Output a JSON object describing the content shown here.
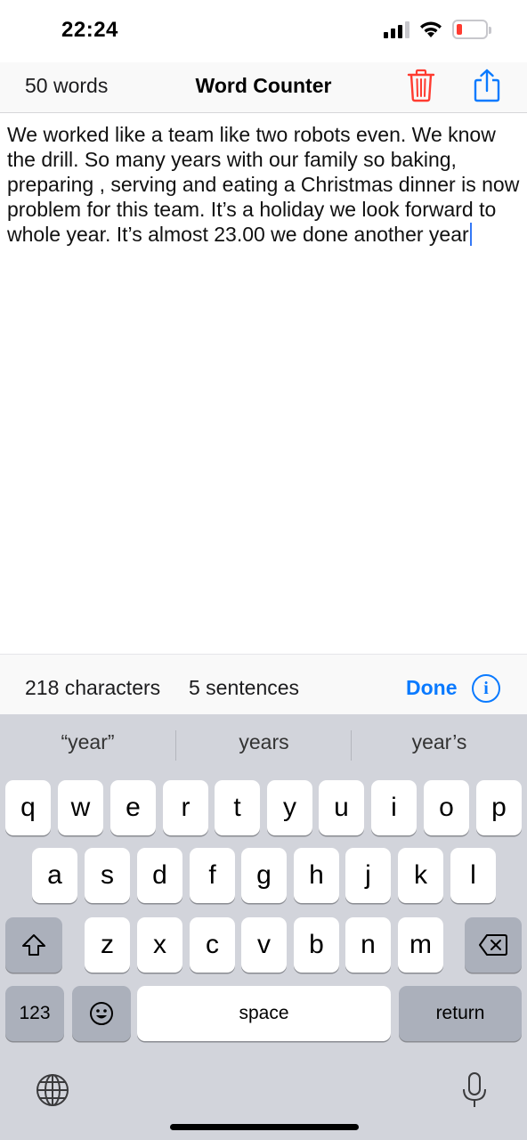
{
  "status_bar": {
    "time": "22:24"
  },
  "nav": {
    "word_count": "50 words",
    "title": "Word Counter"
  },
  "editor": {
    "text": "We worked like a team like two robots even. We know the drill. So many years with our family so baking, preparing , serving and eating a Christmas dinner is now problem for this team. It’s a holiday we look forward to whole year. It’s almost 23.00 we done another year"
  },
  "stats": {
    "characters": "218 characters",
    "sentences": "5 sentences",
    "done_label": "Done",
    "info_glyph": "i"
  },
  "keyboard": {
    "suggestions": [
      "“year”",
      "years",
      "year’s"
    ],
    "row1": [
      "q",
      "w",
      "e",
      "r",
      "t",
      "y",
      "u",
      "i",
      "o",
      "p"
    ],
    "row2": [
      "a",
      "s",
      "d",
      "f",
      "g",
      "h",
      "j",
      "k",
      "l"
    ],
    "row3": [
      "z",
      "x",
      "c",
      "v",
      "b",
      "n",
      "m"
    ],
    "numbers_label": "123",
    "space_label": "space",
    "return_label": "return"
  },
  "colors": {
    "accent": "#0a7aff",
    "trash": "#ff3b30",
    "battery_low": "#ff3b30"
  },
  "icons": {
    "trash": "trash-icon",
    "share": "share-icon",
    "info": "info-icon",
    "shift": "shift-icon",
    "backspace": "backspace-icon",
    "emoji": "emoji-icon",
    "globe": "globe-icon",
    "mic": "microphone-icon"
  }
}
